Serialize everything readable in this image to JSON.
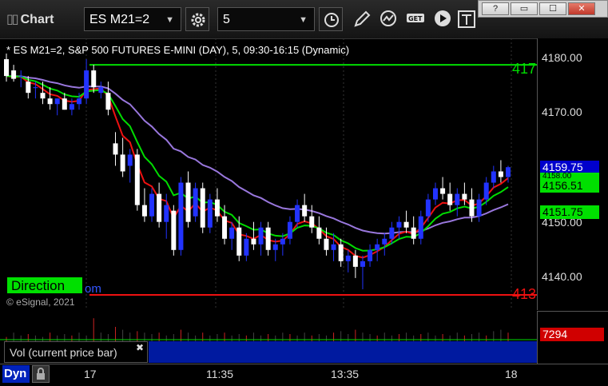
{
  "app": {
    "title": "Chart"
  },
  "toolbar": {
    "symbol": "ES M21=2",
    "interval": "5"
  },
  "chart": {
    "header": "* ES M21=2, S&P 500 FUTURES E-MINI (DAY), 5, 09:30-16:15 (Dynamic)",
    "direction_label": "Direction",
    "direction_tail": "om",
    "copyright": "© eSignal, 2021",
    "right_edge_top": "417",
    "right_edge_bottom": "413",
    "colors": {
      "bull": "#2233ff",
      "bear": "#ffffff",
      "green": "#00dd00",
      "red": "#ee1111",
      "purple": "#9977dd"
    }
  },
  "price_axis": {
    "ticks": [
      "4180.00",
      "4170.00",
      "4150.00",
      "4140.00"
    ],
    "tags": {
      "last": "4159.75",
      "green_upper": "4156.51",
      "green_lower": "4151.75",
      "hidden": "4158.00"
    }
  },
  "volume": {
    "label": "Vol (current price bar)",
    "value": "7294"
  },
  "time_axis": {
    "labels": [
      "17",
      "11:35",
      "13:35",
      "18"
    ],
    "dyn_label": "Dyn"
  },
  "chart_data": {
    "type": "candlestick",
    "y_range": [
      4135,
      4182
    ],
    "candles": [
      [
        4179,
        4180,
        4175,
        4176
      ],
      [
        4177,
        4178,
        4175,
        4175.5
      ],
      [
        4176,
        4177,
        4174,
        4176
      ],
      [
        4175,
        4176,
        4172,
        4173
      ],
      [
        4174,
        4175,
        4172,
        4174
      ],
      [
        4173,
        4175,
        4171,
        4172
      ],
      [
        4172,
        4174,
        4170,
        4171
      ],
      [
        4171,
        4172,
        4169,
        4172
      ],
      [
        4172,
        4173,
        4170,
        4170
      ],
      [
        4170,
        4172,
        4169,
        4171
      ],
      [
        4171,
        4173,
        4170,
        4172
      ],
      [
        4172,
        4179,
        4171,
        4177
      ],
      [
        4177,
        4178,
        4173,
        4174
      ],
      [
        4173,
        4175,
        4172,
        4174
      ],
      [
        4173,
        4175,
        4169,
        4170
      ],
      [
        4164,
        4166,
        4160,
        4162
      ],
      [
        4162,
        4165,
        4158,
        4159
      ],
      [
        4160,
        4163,
        4157,
        4162
      ],
      [
        4162,
        4163,
        4152,
        4153
      ],
      [
        4153,
        4156,
        4150,
        4151
      ],
      [
        4151,
        4156,
        4150,
        4155
      ],
      [
        4155,
        4157,
        4149,
        4150
      ],
      [
        4150,
        4155,
        4147,
        4153
      ],
      [
        4152,
        4153,
        4144,
        4145
      ],
      [
        4145,
        4158,
        4144,
        4157
      ],
      [
        4157,
        4159,
        4149,
        4150
      ],
      [
        4151,
        4157,
        4150,
        4156
      ],
      [
        4156,
        4157,
        4148,
        4149
      ],
      [
        4149,
        4155,
        4148,
        4154
      ],
      [
        4154,
        4156,
        4150,
        4151
      ],
      [
        4151,
        4153,
        4146,
        4147
      ],
      [
        4147,
        4150,
        4145,
        4149
      ],
      [
        4149,
        4151,
        4143,
        4144
      ],
      [
        4144,
        4148,
        4143,
        4147
      ],
      [
        4147,
        4150,
        4145,
        4146
      ],
      [
        4146,
        4150,
        4144,
        4149
      ],
      [
        4149,
        4150,
        4144,
        4145
      ],
      [
        4145,
        4147,
        4143,
        4146
      ],
      [
        4146,
        4148,
        4144,
        4147
      ],
      [
        4147,
        4151,
        4146,
        4150
      ],
      [
        4150,
        4154,
        4149,
        4153
      ],
      [
        4153,
        4155,
        4150,
        4151
      ],
      [
        4151,
        4153,
        4148,
        4149
      ],
      [
        4149,
        4151,
        4146,
        4147
      ],
      [
        4147,
        4149,
        4144,
        4145
      ],
      [
        4145,
        4148,
        4143,
        4146
      ],
      [
        4146,
        4147,
        4142,
        4143
      ],
      [
        4143,
        4145,
        4141,
        4144
      ],
      [
        4144,
        4145,
        4140,
        4142
      ],
      [
        4142,
        4144,
        4138,
        4143
      ],
      [
        4143,
        4146,
        4142,
        4145
      ],
      [
        4145,
        4147,
        4143,
        4146
      ],
      [
        4146,
        4148,
        4144,
        4147
      ],
      [
        4147,
        4150,
        4146,
        4149
      ],
      [
        4149,
        4151,
        4147,
        4150
      ],
      [
        4150,
        4152,
        4148,
        4149
      ],
      [
        4149,
        4151,
        4146,
        4147
      ],
      [
        4147,
        4152,
        4146,
        4151
      ],
      [
        4151,
        4155,
        4150,
        4154
      ],
      [
        4154,
        4157,
        4153,
        4156
      ],
      [
        4156,
        4158,
        4154,
        4155
      ],
      [
        4155,
        4157,
        4152,
        4153
      ],
      [
        4153,
        4156,
        4151,
        4155
      ],
      [
        4155,
        4157,
        4153,
        4154
      ],
      [
        4154,
        4156,
        4150,
        4151
      ],
      [
        4151,
        4155,
        4150,
        4154
      ],
      [
        4154,
        4158,
        4153,
        4157
      ],
      [
        4157,
        4160,
        4156,
        4159
      ],
      [
        4159,
        4161,
        4157,
        4158
      ],
      [
        4158,
        4160,
        4157,
        4159.75
      ]
    ],
    "levels": {
      "top_green": 4178,
      "bottom_red": 4137
    },
    "volume_spikes": [
      0.15,
      0.3,
      0.2,
      0.25,
      0.2,
      0.15,
      0.3,
      0.2,
      0.25,
      0.2,
      0.3,
      0.2,
      0.8,
      0.3,
      0.25,
      0.5,
      0.4,
      0.3,
      0.35,
      0.3,
      0.25,
      0.3,
      0.2,
      0.25,
      0.4,
      0.3,
      0.2,
      0.3,
      0.2,
      0.25,
      0.3,
      0.2,
      0.25,
      0.2,
      0.3,
      0.2,
      0.25,
      0.2,
      0.3,
      0.25,
      0.2,
      0.3,
      0.2,
      0.25,
      0.2,
      0.3,
      0.35,
      0.25,
      0.4,
      0.3,
      0.25,
      0.2,
      0.3,
      0.2,
      0.25,
      0.3,
      0.2,
      0.25,
      0.3,
      0.2,
      0.25,
      0.2,
      0.3,
      0.2,
      0.25,
      0.3,
      0.2,
      0.35,
      0.4,
      0.3
    ]
  }
}
